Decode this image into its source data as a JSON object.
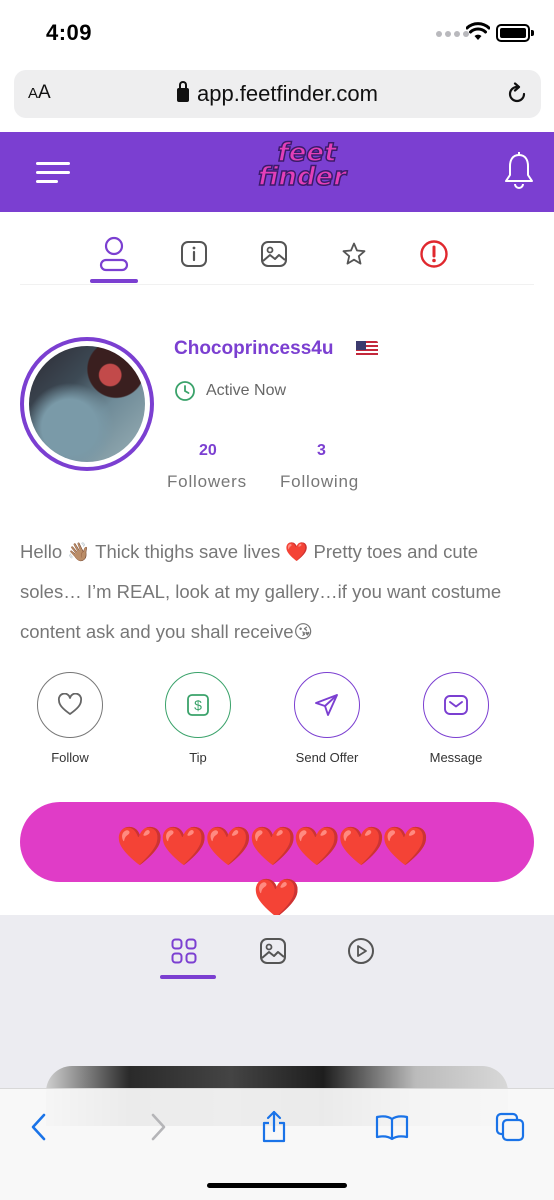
{
  "status_bar": {
    "time": "4:09"
  },
  "browser": {
    "aa_label_a": "A",
    "aa_label_b": "A",
    "url": "app.feetfinder.com"
  },
  "header": {
    "logo_line1": "feet",
    "logo_line2": "finder"
  },
  "profile_tabs": [
    "profile",
    "info",
    "gallery",
    "favorites",
    "report"
  ],
  "profile": {
    "username": "Chocoprincess4u",
    "country_flag": "us-flag",
    "status": "Active Now",
    "followers_count": "20",
    "followers_label": "Followers",
    "following_count": "3",
    "following_label": "Following",
    "bio": "Hello 👋🏽 Thick thighs save lives ❤️ Pretty toes and cute soles… I’m REAL, look at my gallery…if you want costume content ask and you shall receive😘"
  },
  "actions": [
    {
      "label": "Follow",
      "icon": "heart-icon"
    },
    {
      "label": "Tip",
      "icon": "dollar-icon"
    },
    {
      "label": "Send Offer",
      "icon": "send-icon"
    },
    {
      "label": "Message",
      "icon": "mail-icon"
    }
  ],
  "promo": {
    "hearts": "❤️❤️❤️❤️❤️❤️❤️",
    "heart_extra": "❤️"
  },
  "gallery_tabs": [
    "grid",
    "photos",
    "videos"
  ],
  "colors": {
    "brand_purple": "#7b3fd1",
    "promo_pink": "#e03cc7",
    "active_green": "#3aa26a",
    "tip_green": "#3aa26a",
    "report_red": "#e0282e",
    "ios_blue": "#1a73e8"
  }
}
